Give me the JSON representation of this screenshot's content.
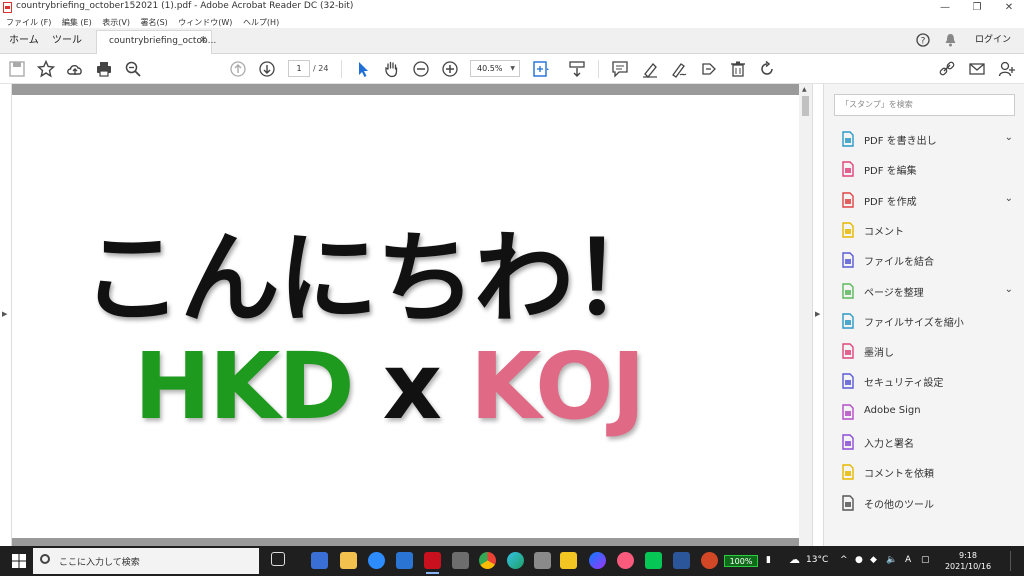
{
  "window": {
    "title": "countrybriefing_october152021 (1).pdf - Adobe Acrobat Reader DC (32-bit)",
    "minimize": "—",
    "maximize": "❐",
    "close": "✕"
  },
  "menu": [
    "ファイル (F)",
    "編集 (E)",
    "表示(V)",
    "署名(S)",
    "ウィンドウ(W)",
    "ヘルプ(H)"
  ],
  "tabs": {
    "home": "ホーム",
    "tools": "ツール",
    "document": "countrybriefing_octob...",
    "close": "×",
    "login": "ログイン"
  },
  "toolbar": {
    "page_current": "1",
    "page_total": "/ 24",
    "zoom": "40.5%"
  },
  "document": {
    "line1": "こんにちわ！",
    "line2_a": "HKD",
    "line2_x": " x ",
    "line2_b": "KOJ",
    "colors": {
      "hkd": "#1e9a1e",
      "koj": "#e06a86",
      "x": "#111111"
    }
  },
  "right_panel": {
    "search_placeholder": "「スタンプ」を検索",
    "tools": [
      {
        "label": "PDF を書き出し",
        "icon": "export-pdf-icon",
        "color": "#2b9ac6",
        "expandable": true
      },
      {
        "label": "PDF を編集",
        "icon": "edit-pdf-icon",
        "color": "#e0457b",
        "expandable": false
      },
      {
        "label": "PDF を作成",
        "icon": "create-pdf-icon",
        "color": "#e04545",
        "expandable": true
      },
      {
        "label": "コメント",
        "icon": "comment-icon",
        "color": "#e6b800",
        "expandable": false
      },
      {
        "label": "ファイルを結合",
        "icon": "combine-files-icon",
        "color": "#5a5ad6",
        "expandable": false
      },
      {
        "label": "ページを整理",
        "icon": "organize-pages-icon",
        "color": "#5cb85c",
        "expandable": true
      },
      {
        "label": "ファイルサイズを縮小",
        "icon": "compress-pdf-icon",
        "color": "#2b9ac6",
        "expandable": false
      },
      {
        "label": "墨消し",
        "icon": "redact-icon",
        "color": "#e0457b",
        "expandable": false
      },
      {
        "label": "セキュリティ設定",
        "icon": "protect-icon",
        "color": "#5a5ad6",
        "expandable": false
      },
      {
        "label": "Adobe Sign",
        "icon": "adobe-sign-icon",
        "color": "#b44cc4",
        "expandable": false
      },
      {
        "label": "入力と署名",
        "icon": "fill-sign-icon",
        "color": "#8a4cd6",
        "expandable": false
      },
      {
        "label": "コメントを依頼",
        "icon": "send-comments-icon",
        "color": "#e6b800",
        "expandable": false
      },
      {
        "label": "その他のツール",
        "icon": "more-tools-icon",
        "color": "#555555",
        "expandable": false
      }
    ]
  },
  "taskbar": {
    "search_placeholder": "ここに入力して検索",
    "battery": "100%",
    "temperature": "13°C",
    "ime": "A",
    "time": "9:18",
    "date": "2021/10/16"
  }
}
